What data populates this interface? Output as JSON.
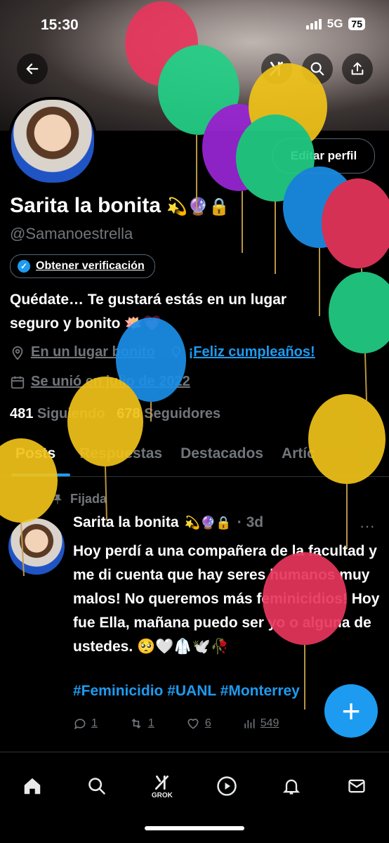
{
  "status": {
    "time": "15:30",
    "network": "5G",
    "battery": "75"
  },
  "profile": {
    "edit_label": "Editar perfil",
    "name": "Sarita la bonita",
    "name_emojis": "💫🔮🔒",
    "handle": "@Samanoestrella",
    "verify_label": "Obtener verificación",
    "bio_line1": "Quédate… Te gustará estás en un lugar",
    "bio_line2": "seguro y bonito 🪷💗",
    "location": "En un lugar bonito",
    "birthday": "¡Feliz cumpleaños!",
    "joined": "Se unió en julio de 2022",
    "following_count": "481",
    "following_label": "Siguiendo",
    "followers_count": "678",
    "followers_label": "Seguidores"
  },
  "tabs": [
    "Posts",
    "Respuestas",
    "Destacados",
    "Artíc"
  ],
  "post": {
    "pinned_label": "Fijada",
    "author": "Sarita la bonita",
    "author_emojis": "💫🔮🔒",
    "time": "· 3d",
    "text": "Hoy perdí a una compañera de la facultad y me di cuenta que hay seres humanos muy malos! No queremos más feminicidios! Hoy fue Ella, mañana puedo ser yo o alguna de ustedes. 🥺🤍🥼🕊️🥀",
    "hashtags": "#Feminicidio #UANL #Monterrey",
    "replies": "1",
    "reposts": "1",
    "likes": "6",
    "views": "549"
  },
  "nav": {
    "grok_label": "GROK"
  },
  "colors": {
    "accent": "#1d9bf0",
    "muted": "#71767b"
  },
  "icons": [
    "back-arrow-icon",
    "grok-icon",
    "search-icon",
    "share-icon",
    "location-icon",
    "balloon-icon",
    "calendar-icon",
    "pin-icon",
    "reply-icon",
    "repost-icon",
    "like-icon",
    "views-icon",
    "plus-icon",
    "home-icon",
    "search-nav-icon",
    "grok-nav-icon",
    "play-icon",
    "bell-icon",
    "mail-icon"
  ]
}
